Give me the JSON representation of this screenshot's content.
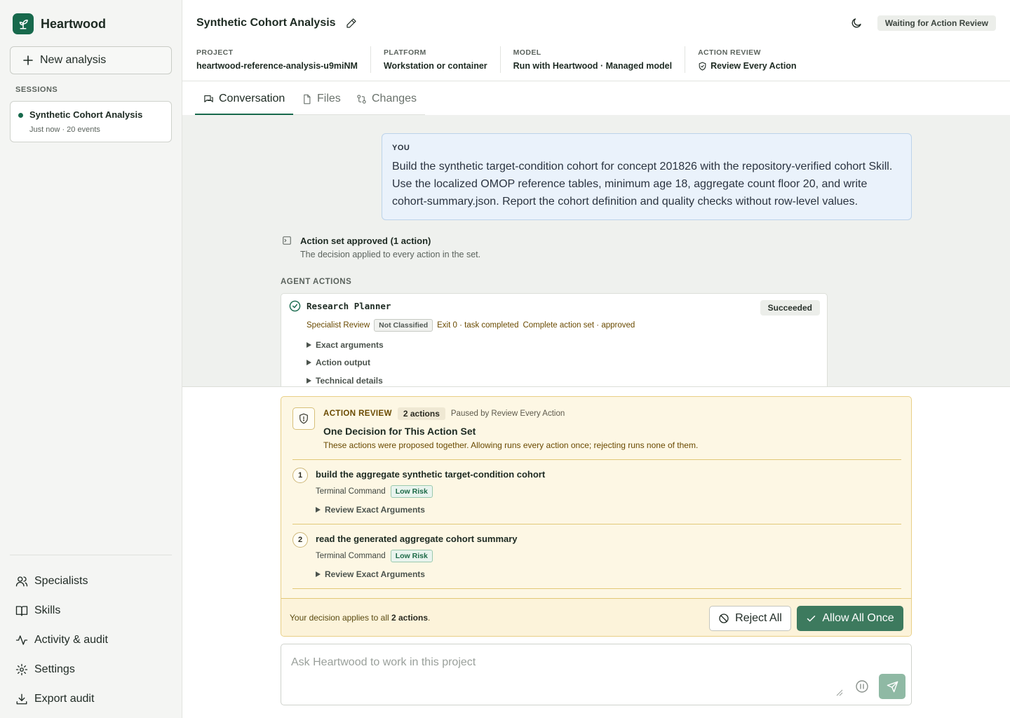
{
  "app": {
    "name": "Heartwood"
  },
  "sidebar": {
    "new_analysis_label": "New analysis",
    "sessions_heading": "SESSIONS",
    "sessions": [
      {
        "title": "Synthetic Cohort Analysis",
        "meta": "Just now · 20 events",
        "status_color": "#17694c"
      }
    ],
    "nav": [
      {
        "label": "Specialists",
        "icon": "people-icon"
      },
      {
        "label": "Skills",
        "icon": "book-icon"
      },
      {
        "label": "Activity & audit",
        "icon": "activity-icon"
      },
      {
        "label": "Settings",
        "icon": "gear-icon"
      },
      {
        "label": "Export audit",
        "icon": "download-icon"
      }
    ]
  },
  "header": {
    "title": "Synthetic Cohort Analysis",
    "status": "Waiting for Action Review",
    "meta": [
      {
        "label": "PROJECT",
        "value": "heartwood-reference-analysis-u9miNM"
      },
      {
        "label": "PLATFORM",
        "value": "Workstation or container"
      },
      {
        "label": "MODEL",
        "value": "Run with Heartwood · Managed model"
      },
      {
        "label": "ACTION REVIEW",
        "value": "Review Every Action"
      }
    ]
  },
  "tabs": [
    {
      "label": "Conversation",
      "active": true
    },
    {
      "label": "Files",
      "active": false
    },
    {
      "label": "Changes",
      "active": false
    }
  ],
  "conversation": {
    "you_label": "YOU",
    "you_text": "Build the synthetic target-condition cohort for concept 201826 with the repository-verified cohort Skill. Use the localized OMOP reference tables, minimum age 18, aggregate count floor 20, and write cohort-summary.json. Report the cohort definition and quality checks without row-level values.",
    "approved_title": "Action set approved (1 action)",
    "approved_sub": "The decision applied to every action in the set.",
    "agent_actions_heading": "AGENT ACTIONS",
    "agent": {
      "name": "Research Planner",
      "status": "Succeeded",
      "role": "Specialist Review",
      "classification": "Not Classified",
      "exit": "Exit 0 · task completed",
      "set_status": "Complete action set · approved",
      "disclosures": [
        "Exact arguments",
        "Action output",
        "Technical details"
      ]
    }
  },
  "review": {
    "label": "ACTION REVIEW",
    "count": "2 actions",
    "paused_by": "Paused by Review Every Action",
    "title": "One Decision for This Action Set",
    "subtitle": "These actions were proposed together. Allowing runs every action once; rejecting runs none of them.",
    "steps": [
      {
        "num": "1",
        "title": "build the aggregate synthetic target-condition cohort",
        "kind": "Terminal Command",
        "risk": "Low Risk",
        "disclosure": "Review Exact Arguments"
      },
      {
        "num": "2",
        "title": "read the generated aggregate cohort summary",
        "kind": "Terminal Command",
        "risk": "Low Risk",
        "disclosure": "Review Exact Arguments"
      }
    ],
    "footer_prefix": "Your decision applies to all ",
    "footer_bold": "2 actions",
    "footer_suffix": ".",
    "reject_label": "Reject All",
    "allow_label": "Allow All Once"
  },
  "composer": {
    "placeholder": "Ask Heartwood to work in this project"
  },
  "colors": {
    "brand": "#17694c",
    "allow_button": "#3d7a5e",
    "review_bg": "#fdf7e4",
    "review_border": "#e8cf86",
    "user_bubble": "#eaf2fb"
  }
}
